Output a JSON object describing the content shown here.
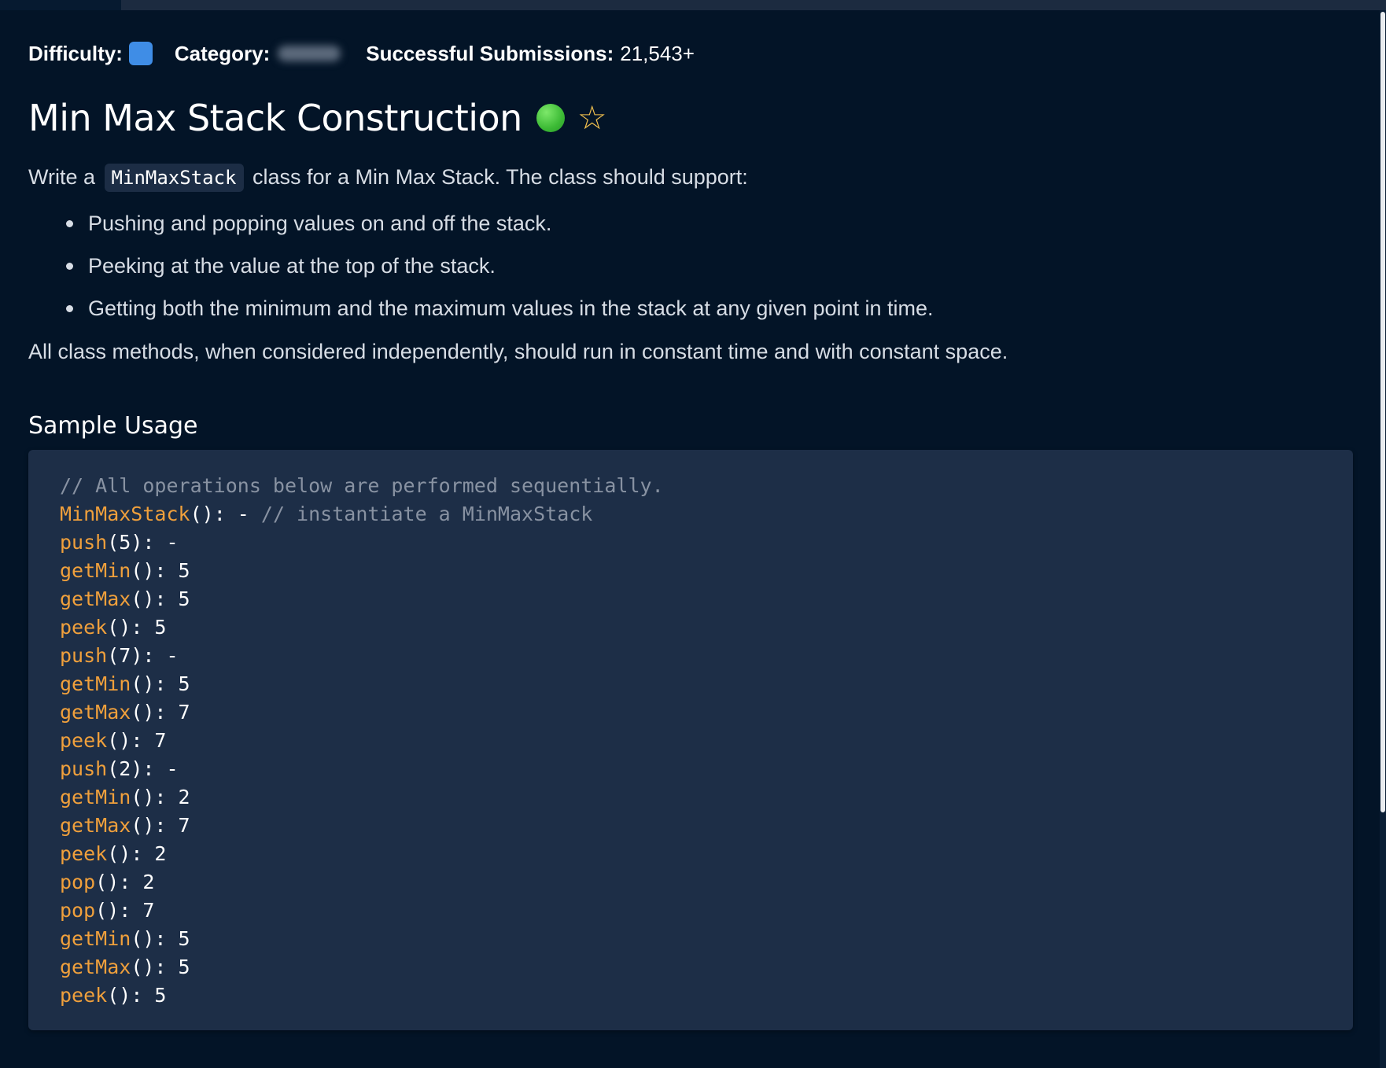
{
  "meta": {
    "difficulty_label": "Difficulty:",
    "category_label": "Category:",
    "submissions_label": "Successful Submissions:",
    "submissions_value": "21,543+",
    "difficulty_color": "#3f8de6"
  },
  "title": {
    "text": "Min Max Stack Construction",
    "status_icon": "completed-dot-icon",
    "favorite_icon": "star-outline-icon",
    "status_color": "#3cba35",
    "star_color": "#f2c14e"
  },
  "description": {
    "intro_before": "Write a",
    "intro_code": "MinMaxStack",
    "intro_after": "class for a Min Max Stack. The class should support:",
    "bullets": [
      "Pushing and popping values on and off the stack.",
      "Peeking at the value at the top of the stack.",
      "Getting both the minimum and the maximum values in the stack at any given point in time."
    ],
    "closing": "All class methods, when considered independently, should run in constant time and with constant space."
  },
  "sample": {
    "heading": "Sample Usage",
    "lines": [
      {
        "fn": "",
        "args": "",
        "result": "",
        "comment": "// All operations below are performed sequentially."
      },
      {
        "fn": "MinMaxStack",
        "args": "()",
        "result": ": - ",
        "comment": "// instantiate a MinMaxStack"
      },
      {
        "fn": "push",
        "args": "(5)",
        "result": ": -",
        "comment": ""
      },
      {
        "fn": "getMin",
        "args": "()",
        "result": ": 5",
        "comment": ""
      },
      {
        "fn": "getMax",
        "args": "()",
        "result": ": 5",
        "comment": ""
      },
      {
        "fn": "peek",
        "args": "()",
        "result": ": 5",
        "comment": ""
      },
      {
        "fn": "push",
        "args": "(7)",
        "result": ": -",
        "comment": ""
      },
      {
        "fn": "getMin",
        "args": "()",
        "result": ": 5",
        "comment": ""
      },
      {
        "fn": "getMax",
        "args": "()",
        "result": ": 7",
        "comment": ""
      },
      {
        "fn": "peek",
        "args": "()",
        "result": ": 7",
        "comment": ""
      },
      {
        "fn": "push",
        "args": "(2)",
        "result": ": -",
        "comment": ""
      },
      {
        "fn": "getMin",
        "args": "()",
        "result": ": 2",
        "comment": ""
      },
      {
        "fn": "getMax",
        "args": "()",
        "result": ": 7",
        "comment": ""
      },
      {
        "fn": "peek",
        "args": "()",
        "result": ": 2",
        "comment": ""
      },
      {
        "fn": "pop",
        "args": "()",
        "result": ": 2",
        "comment": ""
      },
      {
        "fn": "pop",
        "args": "()",
        "result": ": 7",
        "comment": ""
      },
      {
        "fn": "getMin",
        "args": "()",
        "result": ": 5",
        "comment": ""
      },
      {
        "fn": "getMax",
        "args": "()",
        "result": ": 5",
        "comment": ""
      },
      {
        "fn": "peek",
        "args": "()",
        "result": ": 5",
        "comment": ""
      }
    ]
  }
}
